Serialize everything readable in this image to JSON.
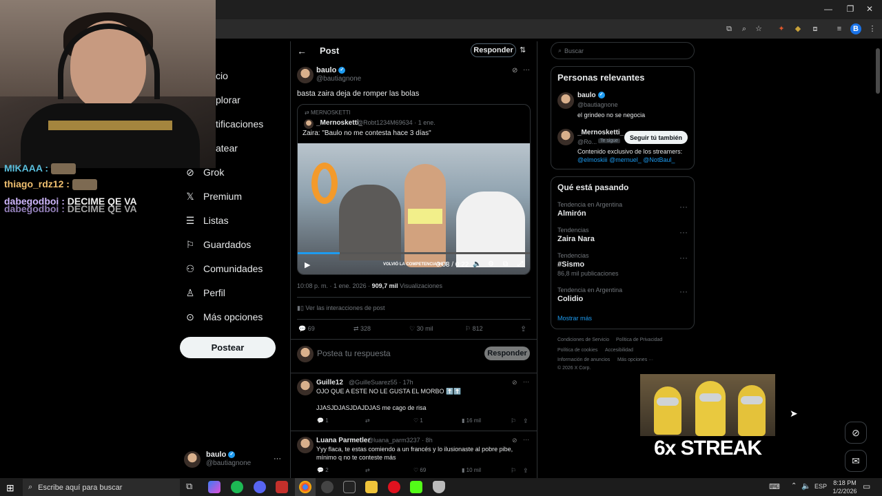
{
  "colors": {
    "accent": "#1d9bf0",
    "background": "#000000",
    "border": "#2f3336",
    "muted": "#71767b"
  },
  "chat": [
    {
      "user": "MIKAAA :",
      "message": ""
    },
    {
      "user": "thiago_rdz12 :",
      "message": ""
    },
    {
      "user": "dabegodboi :",
      "message": "DECIME QE VA"
    },
    {
      "user": "dabegodboi :",
      "message": "DECIME QE VA"
    }
  ],
  "nav": {
    "items": [
      {
        "label": "cio",
        "icon": "home-icon"
      },
      {
        "label": "plorar",
        "icon": "search-icon"
      },
      {
        "label": "tificaciones",
        "icon": "bell-icon"
      },
      {
        "label": "atear",
        "icon": "mail-icon"
      },
      {
        "label": "Grok",
        "icon": "grok-icon"
      },
      {
        "label": "Premium",
        "icon": "x-logo-icon"
      },
      {
        "label": "Listas",
        "icon": "list-icon"
      },
      {
        "label": "Guardados",
        "icon": "bookmark-icon"
      },
      {
        "label": "Comunidades",
        "icon": "people-icon"
      },
      {
        "label": "Perfil",
        "icon": "person-icon"
      },
      {
        "label": "Más opciones",
        "icon": "more-circle-icon"
      }
    ],
    "post_button": "Postear",
    "account": {
      "name": "baulo",
      "handle": "@bautiagnone",
      "more": "···"
    }
  },
  "post": {
    "header_title": "Post",
    "reply_button": "Responder",
    "author_name": "baulo",
    "author_handle": "@bautiagnone",
    "text": "basta zaira deja de romper las bolas",
    "quote": {
      "repost_label": "MERNOSKETTI",
      "author_name": "_Mernosketti_",
      "author_meta": "@Robt1234M69634 · 1 ene.",
      "text": "Zaira: \"Baulo no me contesta hace 3 días\"",
      "video_time": "0:03 / 0:22",
      "video_caption": "VOLVIÓ LA COMPETENCIA DE B"
    },
    "timestamp": "10:08 p. m. · 1 ene. 2026 ·",
    "views_count": "909,7 mil",
    "views_label": "Visualizaciones",
    "interactions_label": "Ver las interacciones de post",
    "stats": {
      "replies": "69",
      "reposts": "328",
      "likes": "30 mil",
      "bookmarks": "812"
    },
    "compose_placeholder": "Postea tu respuesta",
    "compose_button": "Responder"
  },
  "replies": [
    {
      "name": "Guille12",
      "handle": "@GuilleSuarez55 · 17h",
      "line1": "OJO QUE A ESTE NO LE GUSTA EL MORBO ⬆️⬆️",
      "line2": "JJASJDJASJDAJDJAS me cago de risa",
      "stats": {
        "replies": "1",
        "reposts": "",
        "likes": "1",
        "views": "16 mil"
      }
    },
    {
      "name": "Luana Parmetler",
      "handle": "@luana_parm3237 · 8h",
      "line1": "Yyy flaca, te estas comiendo a un francés y lo ilusionaste al pobre pibe,",
      "line2": "mínimo q no te conteste más",
      "stats": {
        "replies": "2",
        "reposts": "",
        "likes": "69",
        "views": "10 mil"
      }
    }
  ],
  "right": {
    "search_placeholder": "Buscar",
    "relevant_title": "Personas relevantes",
    "people": [
      {
        "name": "baulo",
        "handle": "@bautiagnone",
        "bio": "el grindeo no se negocia"
      },
      {
        "name": "_Mernosketti_",
        "handle": "@Ro...",
        "badge": "Te sigue",
        "follow": "Seguir tú también",
        "bio": "Contenido exclusivo de los streamers:",
        "mentions": "@elmoskiii @mernuel_ @NotBaul_"
      }
    ],
    "trending_title": "Qué está pasando",
    "trends": [
      {
        "category": "Tendencia en Argentina",
        "name": "Almirón",
        "posts": ""
      },
      {
        "category": "Tendencias",
        "name": "Zaira Nara",
        "posts": ""
      },
      {
        "category": "Tendencias",
        "name": "#Sismo",
        "posts": "86,8 mil publicaciones"
      },
      {
        "category": "Tendencia en Argentina",
        "name": "Colidio",
        "posts": ""
      }
    ],
    "show_more": "Mostrar más",
    "footer": [
      "Condiciones de Servicio",
      "Política de Privacidad",
      "Política de cookies",
      "Accesibilidad",
      "Información de anuncios",
      "Más opciones ···",
      "© 2026 X Corp."
    ]
  },
  "overlay": {
    "streak_text": "6x STREAK"
  },
  "taskbar": {
    "search_placeholder": "Escribe aquí para buscar",
    "language": "ESP",
    "time": "8:18 PM",
    "date": "1/2/2026"
  }
}
